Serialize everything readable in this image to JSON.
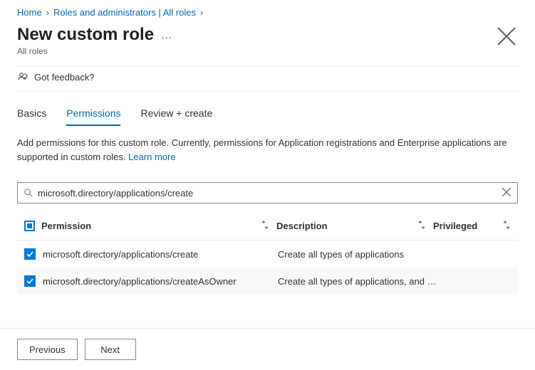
{
  "breadcrumb": {
    "home": "Home",
    "item1": "Roles and administrators | All roles"
  },
  "page": {
    "title": "New custom role",
    "subtitle": "All roles"
  },
  "feedback": {
    "label": "Got feedback?"
  },
  "tabs": {
    "basics": "Basics",
    "permissions": "Permissions",
    "review": "Review + create"
  },
  "description": {
    "text": "Add permissions for this custom role. Currently, permissions for Application registrations and Enterprise applications are supported in custom roles. ",
    "learn_more": "Learn more"
  },
  "search": {
    "value": "microsoft.directory/applications/create"
  },
  "table": {
    "headers": {
      "permission": "Permission",
      "description": "Description",
      "privileged": "Privileged"
    },
    "rows": [
      {
        "permission": "microsoft.directory/applications/create",
        "description": "Create all types of applications",
        "checked": true
      },
      {
        "permission": "microsoft.directory/applications/createAsOwner",
        "description": "Create all types of applications, and …",
        "checked": true
      }
    ]
  },
  "buttons": {
    "previous": "Previous",
    "next": "Next"
  }
}
